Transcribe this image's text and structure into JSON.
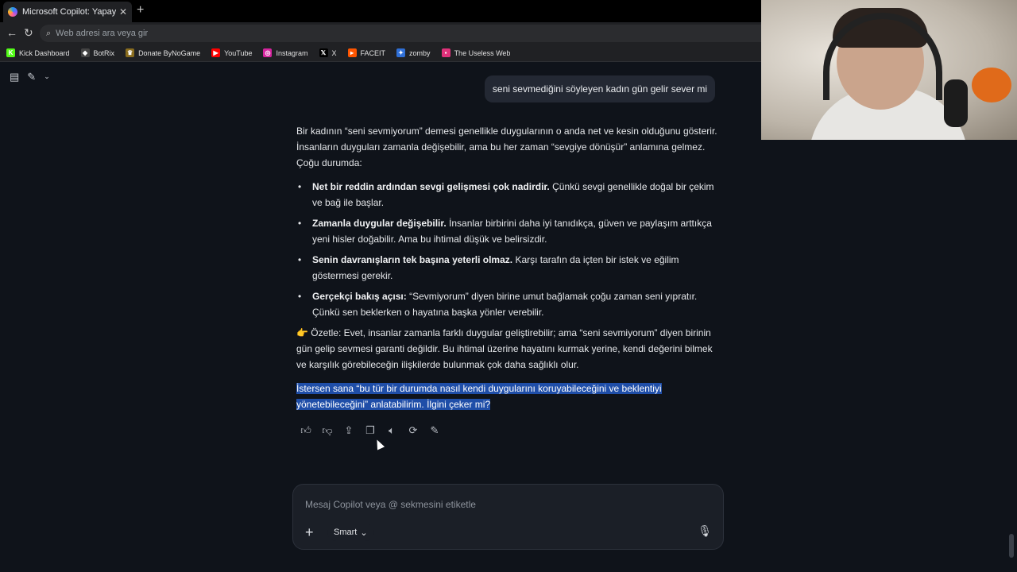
{
  "browser": {
    "tab_title": "Microsoft Copilot: Yapay zeka eşli",
    "tab_close": "✕",
    "new_tab": "+",
    "address_placeholder": "Web adresi ara veya gir",
    "bookmarks": [
      {
        "label": "Kick Dashboard",
        "icon": "kick-icon",
        "color": "#53fc18",
        "glyph": "K"
      },
      {
        "label": "BotRix",
        "icon": "botrix-icon",
        "color": "#444",
        "glyph": "◆"
      },
      {
        "label": "Donate ByNoGame",
        "icon": "bynogame-icon",
        "color": "#8a6d1f",
        "glyph": "♛"
      },
      {
        "label": "YouTube",
        "icon": "youtube-icon",
        "color": "#ff0000",
        "glyph": "▶"
      },
      {
        "label": "Instagram",
        "icon": "instagram-icon",
        "color": "#d6249f",
        "glyph": "◎"
      },
      {
        "label": "X",
        "icon": "x-icon",
        "color": "#000",
        "glyph": "𝕏"
      },
      {
        "label": "FACEIT",
        "icon": "faceit-icon",
        "color": "#ff5500",
        "glyph": "▸"
      },
      {
        "label": "zomby",
        "icon": "zomby-icon",
        "color": "#2f6fd6",
        "glyph": "✦"
      },
      {
        "label": "The Useless Web",
        "icon": "uselessweb-icon",
        "color": "#e0317a",
        "glyph": "▪"
      }
    ]
  },
  "chat": {
    "user_message": "seni sevmediğini söyleyen kadın gün gelir sever mi",
    "intro": "Bir kadının “seni sevmiyorum” demesi genellikle duygularının o anda net ve kesin olduğunu gösterir. İnsanların duyguları zamanla değişebilir, ama bu her zaman “sevgiye dönüşür” anlamına gelmez. Çoğu durumda:",
    "bullets": [
      {
        "bold": "Net bir reddin ardından sevgi gelişmesi çok nadirdir.",
        "text": " Çünkü sevgi genellikle doğal bir çekim ve bağ ile başlar."
      },
      {
        "bold": "Zamanla duygular değişebilir.",
        "text": " İnsanlar birbirini daha iyi tanıdıkça, güven ve paylaşım arttıkça yeni hisler doğabilir. Ama bu ihtimal düşük ve belirsizdir."
      },
      {
        "bold": "Senin davranışların tek başına yeterli olmaz.",
        "text": " Karşı tarafın da içten bir istek ve eğilim göstermesi gerekir."
      },
      {
        "bold": "Gerçekçi bakış açısı:",
        "text": " “Sevmiyorum” diyen birine umut bağlamak çoğu zaman seni yıpratır. Çünkü sen beklerken o hayatına başka yönler verebilir."
      }
    ],
    "summary": "👉 Özetle: Evet, insanlar zamanla farklı duygular geliştirebilir; ama “seni sevmiyorum” diyen birinin gün gelip sevmesi garanti değildir. Bu ihtimal üzerine hayatını kurmak yerine, kendi değerini bilmek ve karşılık görebileceğin ilişkilerde bulunmak çok daha sağlıklı olur.",
    "followup": "İstersen sana “bu tür bir durumda nasıl kendi duygularını koruyabileceğini ve beklentiyi yönetebileceğini” anlatabilirim. İlgini çeker mi?"
  },
  "composer": {
    "placeholder": "Mesaj Copilot veya @ sekmesini etiketle",
    "mode_label": "Smart"
  },
  "colors": {
    "selection": "#1f4ea8",
    "background": "#0f131a"
  }
}
